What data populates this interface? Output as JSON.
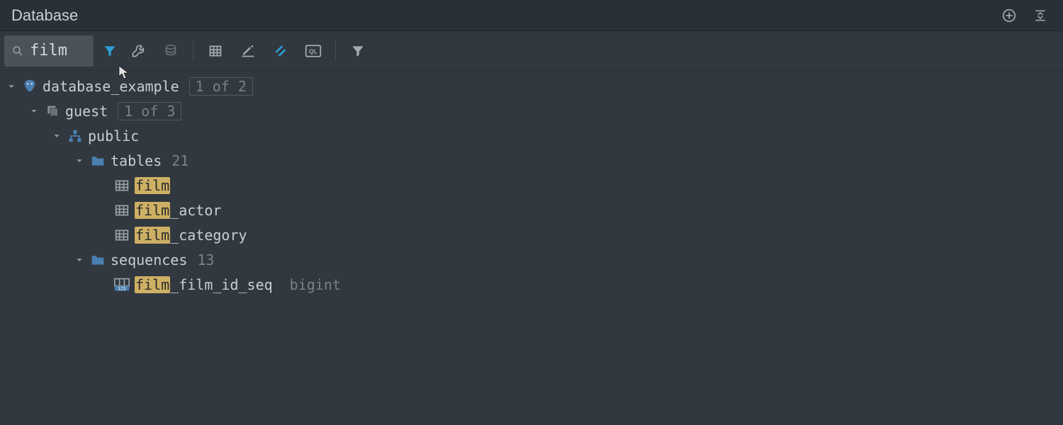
{
  "panel": {
    "title": "Database"
  },
  "search": {
    "value": "film"
  },
  "tree": {
    "datasource": {
      "name": "database_example",
      "badge": "1 of 2",
      "schema_group": {
        "name": "guest",
        "badge": "1 of 3",
        "schema": {
          "name": "public",
          "tables_folder": {
            "label": "tables",
            "count": "21",
            "items": [
              {
                "hl": "film",
                "rest": ""
              },
              {
                "hl": "film",
                "rest": "_actor"
              },
              {
                "hl": "film",
                "rest": "_category"
              }
            ]
          },
          "sequences_folder": {
            "label": "sequences",
            "count": "13",
            "items": [
              {
                "hl": "film",
                "rest": "_film_id_seq",
                "type": "bigint"
              }
            ]
          }
        }
      }
    }
  }
}
